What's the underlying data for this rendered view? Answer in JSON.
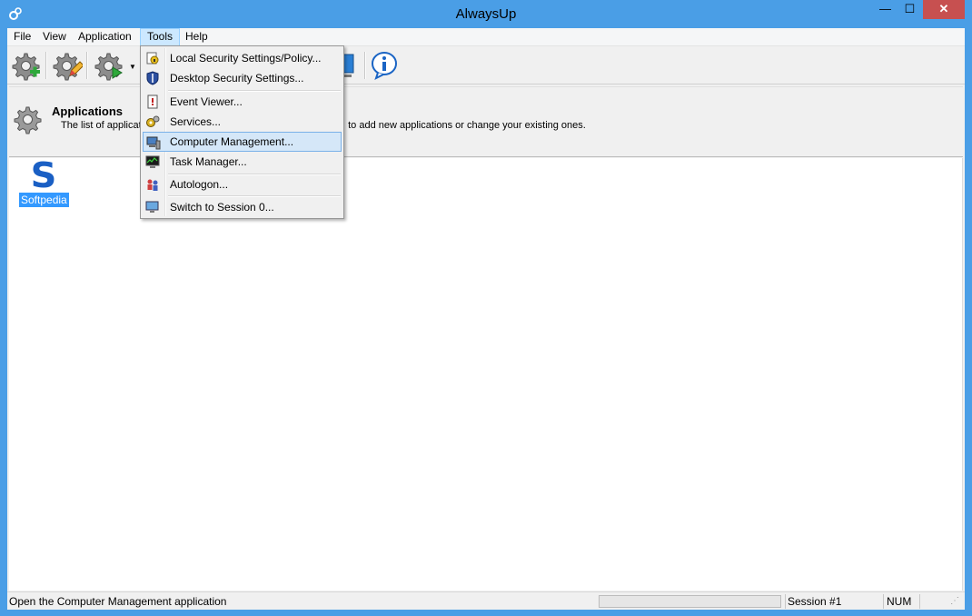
{
  "window": {
    "title": "AlwaysUp",
    "controls": {
      "minimize": "—",
      "maximize": "☐",
      "close": "✕"
    }
  },
  "menubar": {
    "items": [
      {
        "label": "File"
      },
      {
        "label": "View"
      },
      {
        "label": "Application"
      },
      {
        "label": "Tools"
      },
      {
        "label": "Help"
      }
    ],
    "active": "Tools"
  },
  "toolbar": {
    "buttons": [
      {
        "icon": "gear-add-icon"
      },
      {
        "icon": "gear-edit-icon"
      },
      {
        "icon": "gear-start-icon"
      },
      {
        "icon": "monitor-icon"
      },
      {
        "icon": "info-icon"
      }
    ]
  },
  "header_panel": {
    "title": "Applications",
    "description_left": "The list of applicati",
    "description_right": "to add new applications or change your existing ones."
  },
  "content": {
    "apps": [
      {
        "label": "Softpedia",
        "logo": "S"
      }
    ]
  },
  "tools_menu": {
    "items": [
      {
        "label": "Local Security Settings/Policy...",
        "icon": "security-policy-icon"
      },
      {
        "label": "Desktop Security Settings...",
        "icon": "shield-icon"
      },
      {
        "label": "Event Viewer...",
        "icon": "event-viewer-icon"
      },
      {
        "label": "Services...",
        "icon": "services-gear-icon"
      },
      {
        "label": "Computer Management...",
        "icon": "computer-management-icon"
      },
      {
        "label": "Task Manager...",
        "icon": "task-manager-icon"
      },
      {
        "label": "Autologon...",
        "icon": "autologon-icon"
      },
      {
        "label": "Switch to Session 0...",
        "icon": "switch-session-icon"
      }
    ],
    "highlighted": "Computer Management..."
  },
  "statusbar": {
    "message": "Open the Computer Management application",
    "session": "Session #1",
    "num": "NUM"
  },
  "colors": {
    "frame": "#4a9ee6",
    "selection": "#3399ff",
    "menu_highlight": "#d5e7f8"
  }
}
